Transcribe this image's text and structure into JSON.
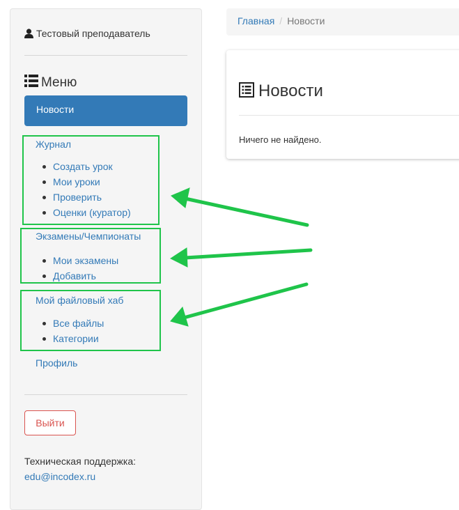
{
  "sidebar": {
    "user_name": "Тестовый преподаватель",
    "menu_title": "Меню",
    "active_item": "Новости",
    "groups": [
      {
        "label": "Журнал",
        "items": [
          "Создать урок",
          "Мои уроки",
          "Проверить",
          "Оценки (куратор)"
        ]
      },
      {
        "label": "Экзамены/Чемпионаты",
        "items": [
          "Мои экзамены",
          "Добавить"
        ]
      },
      {
        "label": "Мой файловый хаб",
        "items": [
          "Все файлы",
          "Категории"
        ]
      }
    ],
    "profile": "Профиль",
    "logout": "Выйти",
    "support_label": "Техническая поддержка:",
    "support_email": "edu@incodex.ru"
  },
  "breadcrumb": {
    "home": "Главная",
    "separator": "/",
    "current": "Новости"
  },
  "panel": {
    "title": "Новости",
    "empty_text": "Ничего не найдено."
  },
  "icons": {
    "user": "user-icon",
    "menu": "list-icon",
    "news": "list-alt-icon"
  },
  "colors": {
    "link": "#337ab7",
    "active_bg": "#337ab7",
    "danger": "#d9534f",
    "highlight": "#1fc44a",
    "sidebar_bg": "#f5f5f5"
  }
}
